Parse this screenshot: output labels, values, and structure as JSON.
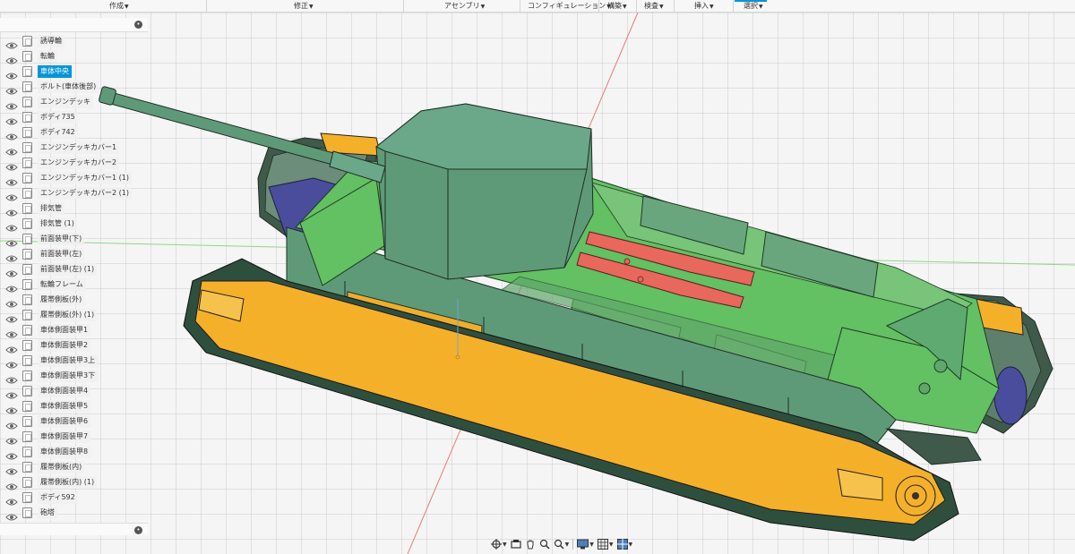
{
  "toolbar": {
    "menus": [
      {
        "label": "作成"
      },
      {
        "label": "修正"
      },
      {
        "label": "アセンブリ"
      },
      {
        "label": "コンフィギュレーション"
      },
      {
        "label": "構築"
      },
      {
        "label": "検査"
      },
      {
        "label": "挿入"
      },
      {
        "label": "選択"
      }
    ]
  },
  "browser": {
    "items": [
      {
        "label": "誘導輪"
      },
      {
        "label": "転輪"
      },
      {
        "label": "車体中央",
        "selected": true
      },
      {
        "label": "ボルト(車体後部)"
      },
      {
        "label": "エンジンデッキ"
      },
      {
        "label": "ボディ735"
      },
      {
        "label": "ボディ742"
      },
      {
        "label": "エンジンデッキカバー1"
      },
      {
        "label": "エンジンデッキカバー2"
      },
      {
        "label": "エンジンデッキカバー1 (1)"
      },
      {
        "label": "エンジンデッキカバー2 (1)"
      },
      {
        "label": "排気管"
      },
      {
        "label": "排気管 (1)"
      },
      {
        "label": "前面装甲(下)"
      },
      {
        "label": "前面装甲(左)"
      },
      {
        "label": "前面装甲(左) (1)"
      },
      {
        "label": "転輪フレーム"
      },
      {
        "label": "履帯側板(外)"
      },
      {
        "label": "履帯側板(外) (1)"
      },
      {
        "label": "車体側面装甲1"
      },
      {
        "label": "車体側面装甲2"
      },
      {
        "label": "車体側面装甲3上"
      },
      {
        "label": "車体側面装甲3下"
      },
      {
        "label": "車体側面装甲4"
      },
      {
        "label": "車体側面装甲5"
      },
      {
        "label": "車体側面装甲6"
      },
      {
        "label": "車体側面装甲7"
      },
      {
        "label": "車体側面装甲8"
      },
      {
        "label": "履帯側板(内)"
      },
      {
        "label": "履帯側板(内) (1)"
      },
      {
        "label": "ボディ592"
      },
      {
        "label": "砲塔"
      }
    ]
  },
  "navbar": {
    "tools": [
      "orbit-icon",
      "look-at-icon",
      "pan-icon",
      "zoom-icon",
      "zoom-window-icon",
      "display-settings-icon",
      "grid-settings-icon",
      "viewports-icon"
    ]
  },
  "colors": {
    "accent": "#0696d7",
    "hull": "#5f9a78",
    "deck": "#63c063",
    "track_plate": "#f5b02a",
    "exhaust": "#e8685e",
    "wheel": "#4a4d9c"
  }
}
